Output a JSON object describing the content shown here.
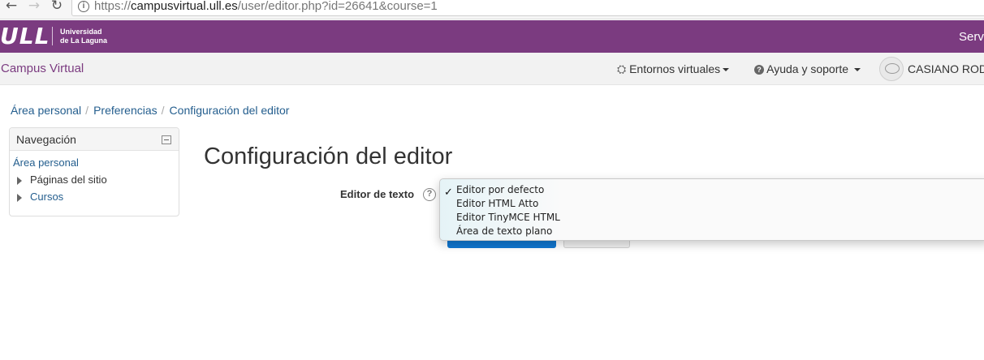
{
  "browser": {
    "back_icon": "←",
    "forward_icon": "→",
    "reload_icon": "↻",
    "info_icon": "i",
    "url_scheme": "https://",
    "url_host": "campusvirtual.ull.es",
    "url_path": "/user/editor.php?id=26641&course=1"
  },
  "brand": {
    "logo_text": "ULL",
    "university_line1": "Universidad",
    "university_line2": "de La Laguna",
    "right_text": "Servi",
    "color": "#7b3b80"
  },
  "navbar": {
    "site_name": "Campus Virtual",
    "entornos_icon": "⛭",
    "entornos_label": "Entornos virtuales",
    "help_icon": "?",
    "ayuda_label": "Ayuda y soporte",
    "user_name": "CASIANO ROD"
  },
  "breadcrumb": {
    "items": [
      "Área personal",
      "Preferencias",
      "Configuración del editor"
    ],
    "separator": "/"
  },
  "navigation_block": {
    "title": "Navegación",
    "home": "Área personal",
    "site_pages": "Páginas del sitio",
    "courses": "Cursos"
  },
  "main": {
    "title": "Configuración del editor",
    "field_label": "Editor de texto",
    "help_glyph": "?"
  },
  "dropdown": {
    "check_glyph": "✓",
    "options": [
      "Editor por defecto",
      "Editor HTML Atto",
      "Editor TinyMCE HTML",
      "Área de texto plano"
    ],
    "selected_index": 0
  },
  "colors": {
    "primary_button": "#1177d1",
    "link": "#245e8e"
  }
}
